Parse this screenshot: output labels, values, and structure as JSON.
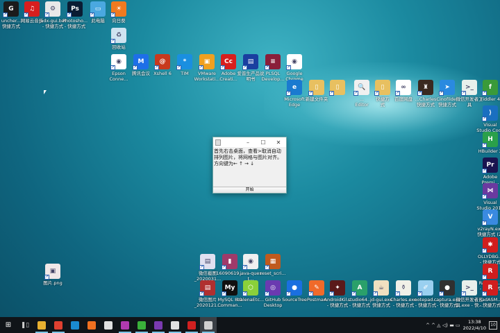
{
  "desktop_icons": [
    {
      "label": "uncher...\n快捷方式",
      "color": "#1b1b1b",
      "glyph": "G"
    },
    {
      "label": "网易云音乐",
      "color": "#d81e1e",
      "glyph": "♫"
    },
    {
      "label": "jadx-gui.bat\n- 快捷方式",
      "color": "#e8e8e8",
      "glyph": "⚙"
    },
    {
      "label": "Photosho...\n- 快捷方式",
      "color": "#0a1c33",
      "glyph": "Ps"
    },
    {
      "label": "此电脑",
      "color": "#4aa8e0",
      "glyph": "▭"
    },
    {
      "label": "向日葵",
      "color": "#f07a20",
      "glyph": "☀"
    },
    {
      "label": "回收站",
      "color": "#cfe3f0",
      "glyph": "♻"
    },
    {
      "label": "Epson\nConne...",
      "color": "#ffffff",
      "glyph": "◉"
    },
    {
      "label": "腾讯会议",
      "color": "#1e6fe8",
      "glyph": "M"
    },
    {
      "label": "Xshell 6",
      "color": "#c8391e",
      "glyph": "@"
    },
    {
      "label": "TIM",
      "color": "#1a8fe0",
      "glyph": "*"
    },
    {
      "label": "VMware\nWorkstati...",
      "color": "#f0a020",
      "glyph": "▣"
    },
    {
      "label": "Adobe\nCreati...",
      "color": "#d81e1e",
      "glyph": "Cc"
    },
    {
      "label": "爱普生产品说\n明书",
      "color": "#1a3fa0",
      "glyph": "▤"
    },
    {
      "label": "PLSQL\nDevelop...",
      "color": "#8a1e3a",
      "glyph": "≡"
    },
    {
      "label": "Google\nChrome",
      "color": "#ffffff",
      "glyph": "◉"
    },
    {
      "label": "Microsoft\nEdge",
      "color": "#1a7ad0",
      "glyph": "e"
    },
    {
      "label": "新建文件夹",
      "color": "#e8c060",
      "glyph": "▯"
    },
    {
      "label": "",
      "color": "#e8c060",
      "glyph": "▯"
    },
    {
      "label": "...\nEditor",
      "color": "#f0f0f0",
      "glyph": "🔍"
    },
    {
      "label": "快捷方\n式",
      "color": "#e8c060",
      "glyph": "▯"
    },
    {
      "label": "百度网盘",
      "color": "#ffffff",
      "glyph": "∞"
    },
    {
      "label": "...Charles\n快捷方式",
      "color": "#3a2a20",
      "glyph": "♜"
    },
    {
      "label": "Cinofilder\n快捷方式",
      "color": "#2a8ae0",
      "glyph": "➤"
    },
    {
      "label": "微信开发者工\n具",
      "color": "#e8f0ec",
      "glyph": ">_"
    },
    {
      "label": "Fiddler 4",
      "color": "#3a9a3a",
      "glyph": "f"
    },
    {
      "label": "Visual\nStudio Code",
      "color": "#1a6fc0",
      "glyph": "⟩"
    },
    {
      "label": "HBuilder X",
      "color": "#2aa04a",
      "glyph": "H"
    },
    {
      "label": "Adobe\nPremi...",
      "color": "#1a1450",
      "glyph": "Pr"
    },
    {
      "label": "Visual\nStudio 2015",
      "color": "#6a3aa0",
      "glyph": "⋈"
    },
    {
      "label": "v2rayN.exe\n快捷方式 (2)",
      "color": "#3a8ae0",
      "glyph": "V"
    },
    {
      "label": "OLLYDBG...\n- 快捷方式",
      "color": "#d01e1e",
      "glyph": "✱"
    },
    {
      "label": "RadASM...\n- 快捷方式",
      "color": "#d01e1e",
      "glyph": "R"
    },
    {
      "label": "微信截图\n_2020031...",
      "color": "#e0e0f0",
      "glyph": "▤"
    },
    {
      "label": "16090619...",
      "color": "#a03a6a",
      "glyph": "▮"
    },
    {
      "label": "java-quest...",
      "color": "#f0f0f0",
      "glyph": "◉"
    },
    {
      "label": "reset_scri...",
      "color": "#c05a1e",
      "glyph": "▦"
    },
    {
      "label": "微信图片\n_2020121...",
      "color": "#b03030",
      "glyph": "▤"
    },
    {
      "label": "MySQL 8.0\nComman...",
      "color": "#101010",
      "glyph": "My"
    },
    {
      "label": "balenaEtc...",
      "color": "#8ad03a",
      "glyph": "⬡"
    },
    {
      "label": "GitHub\nDesktop",
      "color": "#6a3ab0",
      "glyph": "◎"
    },
    {
      "label": "SourceTree",
      "color": "#1a6fe0",
      "glyph": "●"
    },
    {
      "label": "Postman",
      "color": "#f06a2a",
      "glyph": "✎"
    },
    {
      "label": "AndroidKil...\n- 快捷方式",
      "color": "#5a1a1a",
      "glyph": "✦"
    },
    {
      "label": "studio64...\n- 快捷方式",
      "color": "#2aa06a",
      "glyph": "A"
    },
    {
      "label": "jd-gui.exe\n快捷方式",
      "color": "#f0e0c0",
      "glyph": "☕"
    },
    {
      "label": "Charles.exe\n- 快捷方式",
      "color": "#f0f0e8",
      "glyph": "⚱"
    },
    {
      "label": "notepad...\n- 快捷方式",
      "color": "#9ad0f0",
      "glyph": "✐"
    },
    {
      "label": "captura.exe\n- 快捷方式",
      "color": "#303030",
      "glyph": "●"
    },
    {
      "label": "微信开发者工\n具.exe - 快...",
      "color": "#e8f0ec",
      "glyph": ">_"
    },
    {
      "label": "RadASM...\n- 快捷方式",
      "color": "#d01e1e",
      "glyph": "R"
    },
    {
      "label": "图片.png",
      "color": "#f0e8e8",
      "glyph": "▣"
    }
  ],
  "dialog": {
    "minimize": "–",
    "maximize": "☐",
    "close": "✕",
    "message": "首先右击桌面，查看>取消自动排列图片，将网格与图片对齐。方向键为← ↑ → ↓",
    "start_button": "开始"
  },
  "taskbar": {
    "apps": [
      {
        "name": "file-explorer",
        "color": "#e8b030",
        "running": true
      },
      {
        "name": "chrome",
        "color": "#e04030",
        "running": true
      },
      {
        "name": "edge",
        "color": "#1a8ad0",
        "running": false
      },
      {
        "name": "firefox",
        "color": "#f07020",
        "running": false
      },
      {
        "name": "app-penguin",
        "color": "#e0e0e0",
        "running": false
      },
      {
        "name": "jetbrains",
        "color": "#b03ab0",
        "running": true
      },
      {
        "name": "wechat",
        "color": "#3ab03a",
        "running": true
      },
      {
        "name": "visual-studio",
        "color": "#7a3ab0",
        "running": true
      },
      {
        "name": "app-penguin-2",
        "color": "#e0e0e0",
        "running": true
      },
      {
        "name": "recorder",
        "color": "#d02020",
        "running": true
      },
      {
        "name": "java-app",
        "color": "#d0d0d0",
        "running": true,
        "active": true
      }
    ],
    "tray_icons": "^ ^ ◬ ◁) ▬ ▭",
    "time": "13:38",
    "date": "2022/4/10",
    "notifications": "10"
  }
}
